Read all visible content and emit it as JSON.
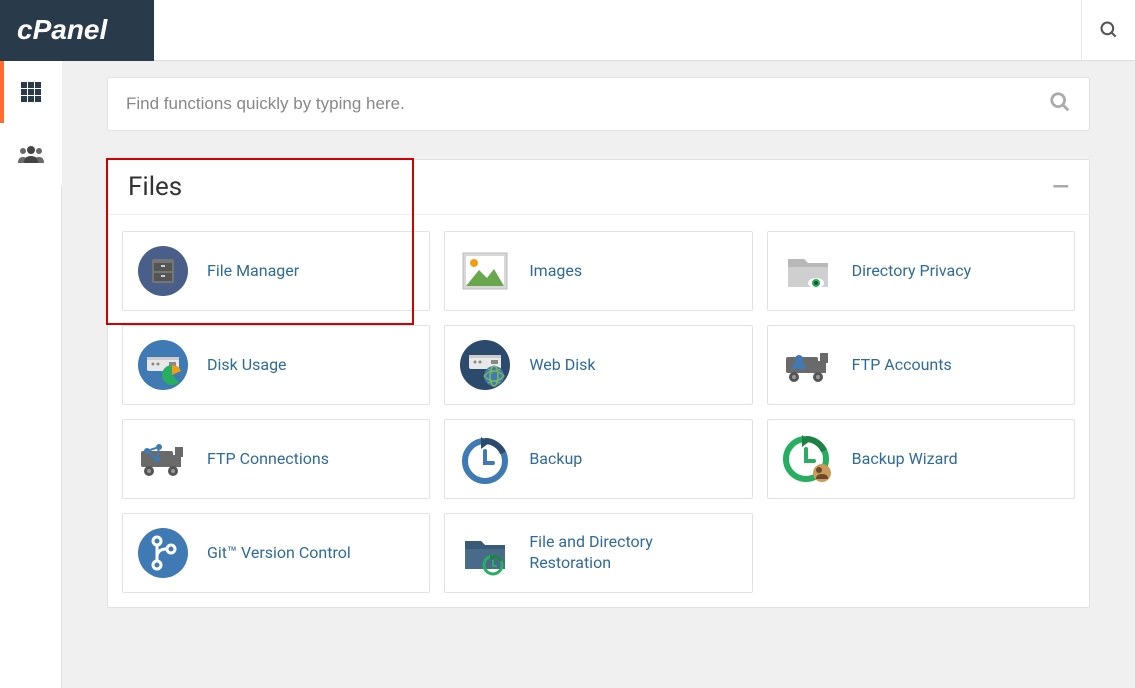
{
  "brand": "cPanel",
  "search": {
    "placeholder": "Find functions quickly by typing here."
  },
  "panel": {
    "title": "Files",
    "collapse_glyph": "—"
  },
  "tools": {
    "file_manager": "File Manager",
    "images": "Images",
    "directory_privacy": "Directory Privacy",
    "disk_usage": "Disk Usage",
    "web_disk": "Web Disk",
    "ftp_accounts": "FTP Accounts",
    "ftp_connections": "FTP Connections",
    "backup": "Backup",
    "backup_wizard": "Backup Wizard",
    "git_version_control": "Git™ Version Control",
    "file_directory_restoration": "File and Directory Restoration"
  }
}
